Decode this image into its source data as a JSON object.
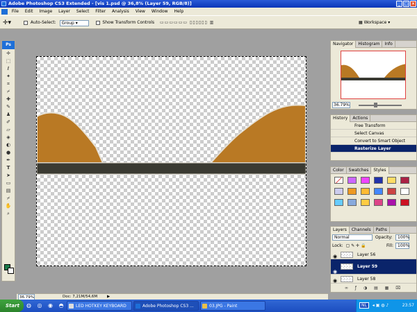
{
  "window": {
    "title": "Adobe Photoshop CS3 Extended - [vis 1.psd @ 36,8% (Layer 59, RGB/8)]"
  },
  "menu": [
    "File",
    "Edit",
    "Image",
    "Layer",
    "Select",
    "Filter",
    "Analysis",
    "View",
    "Window",
    "Help"
  ],
  "options": {
    "auto_select_label": "Auto-Select:",
    "auto_select_value": "Group",
    "show_transform_label": "Show Transform Controls",
    "workspace_label": "Workspace"
  },
  "toolbox": {
    "logo": "Ps"
  },
  "statusbar": {
    "zoom": "36.79%",
    "doc": "Doc: 7,21M/54,6M"
  },
  "navigator": {
    "tabs": [
      "Navigator",
      "Histogram",
      "Info"
    ],
    "zoom": "36.79%"
  },
  "history": {
    "tabs": [
      "History",
      "Actions"
    ],
    "items": [
      "Free Transform",
      "Select Canvas",
      "Convert to Smart Object",
      "Rasterize Layer"
    ],
    "active_index": 3
  },
  "styles": {
    "tabs": [
      "Color",
      "Swatches",
      "Styles"
    ]
  },
  "layers": {
    "tabs": [
      "Layers",
      "Channels",
      "Paths"
    ],
    "blend_mode": "Normal",
    "opacity_label": "Opacity:",
    "opacity_value": "100%",
    "lock_label": "Lock:",
    "fill_label": "Fill:",
    "fill_value": "100%",
    "rows": [
      "Layer 56",
      "Layer 59",
      "Layer 58"
    ],
    "active_row": 1
  },
  "taskbar": {
    "start": "Start",
    "tasks": [
      "LED HOTKEY KEYBOARD",
      "Adobe Photoshop CS3 ...",
      "03.JPG - Paint"
    ],
    "active_task": 1,
    "tray_lang": "NL",
    "clock": "23:57"
  },
  "colors": {
    "accent": "#0a246a",
    "terrain": "#b97924",
    "ground": "#3a3a32",
    "foreground_swatch": "#1a7a4a"
  }
}
